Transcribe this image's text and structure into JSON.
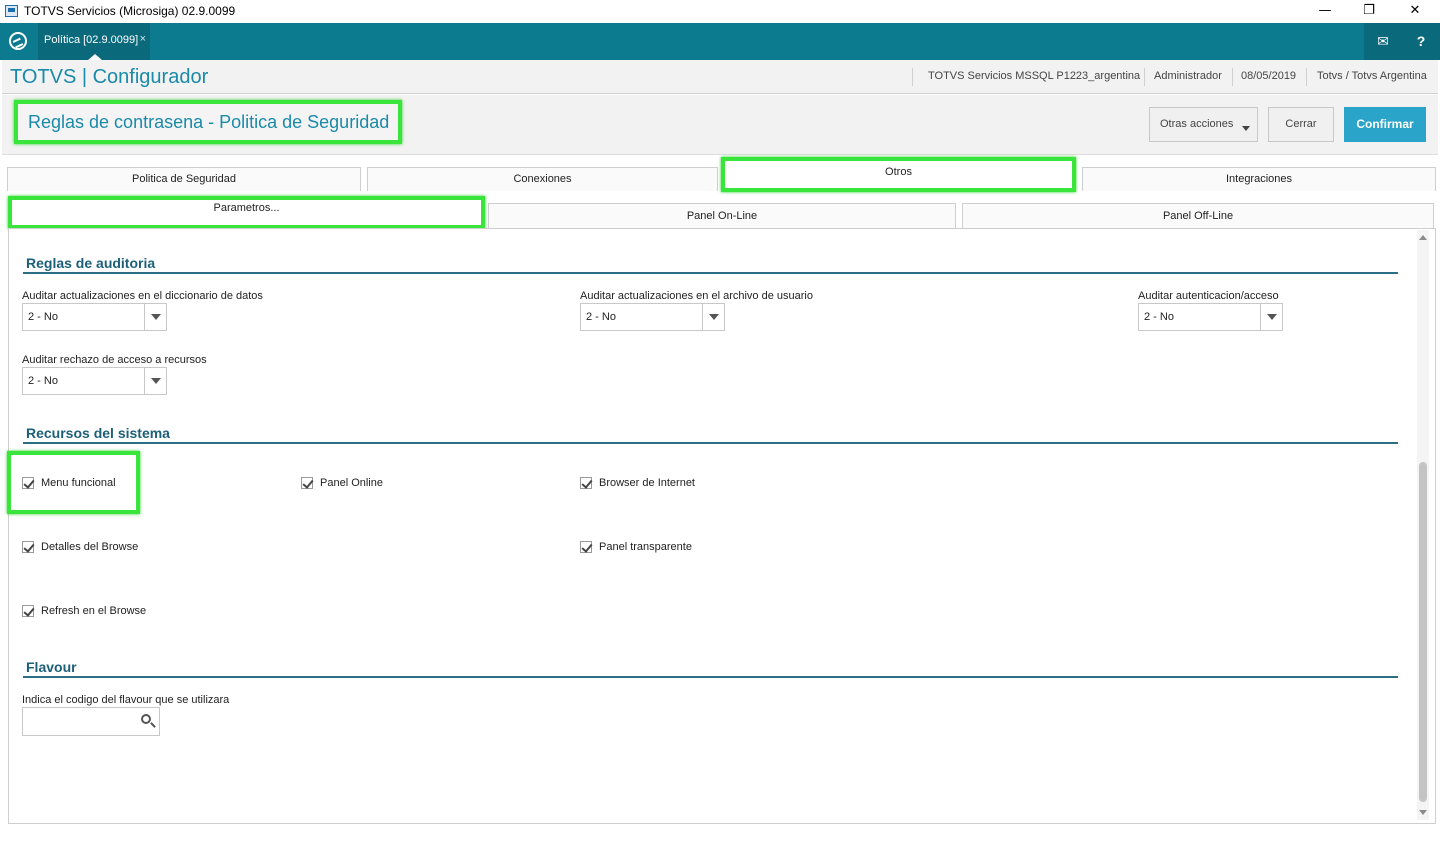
{
  "window": {
    "title": "TOTVS Servicios (Microsiga) 02.9.0099",
    "minimize": "—",
    "restore": "❐",
    "close": "✕"
  },
  "app_tab": {
    "label": "Política [02.9.0099]",
    "close": "×"
  },
  "header_icons": {
    "mail": "✉",
    "help": "?"
  },
  "header": {
    "brand": "TOTVS | Configurador",
    "server": "TOTVS Servicios MSSQL P1223_argentina",
    "user": "Administrador",
    "date": "08/05/2019",
    "company": "Totvs / Totvs Argentina"
  },
  "page": {
    "title": "Reglas de contrasena - Politica de Seguridad"
  },
  "actions": {
    "other": "Otras acciones",
    "close": "Cerrar",
    "confirm": "Confirmar"
  },
  "tabs": [
    {
      "label": "Politica de Seguridad"
    },
    {
      "label": "Conexiones"
    },
    {
      "label": "Otros"
    },
    {
      "label": "Integraciones"
    }
  ],
  "subtabs": [
    {
      "label": "Parametros..."
    },
    {
      "label": "Panel On-Line"
    },
    {
      "label": "Panel Off-Line"
    }
  ],
  "audit": {
    "title": "Reglas de auditoria",
    "fields": [
      {
        "label": "Auditar actualizaciones en el diccionario de datos",
        "value": "2 - No"
      },
      {
        "label": "Auditar actualizaciones en el archivo de usuario",
        "value": "2 - No"
      },
      {
        "label": "Auditar autenticacion/acceso",
        "value": "2 - No"
      },
      {
        "label": "Auditar rechazo de acceso a recursos",
        "value": "2 - No"
      }
    ]
  },
  "resources": {
    "title": "Recursos del sistema",
    "items": [
      {
        "label": "Menu funcional",
        "checked": true
      },
      {
        "label": "Panel Online",
        "checked": true
      },
      {
        "label": "Browser de Internet",
        "checked": true
      },
      {
        "label": "Detalles del Browse",
        "checked": true
      },
      {
        "label": "Panel transparente",
        "checked": true
      },
      {
        "label": "Refresh en el Browse",
        "checked": true
      }
    ]
  },
  "flavour": {
    "title": "Flavour",
    "label": "Indica el codigo del flavour que se utilizara",
    "value": ""
  },
  "colors": {
    "teal_bar": "#0d7b8f",
    "brand_text": "#1a8aa8",
    "confirm_button": "#2aa4c8",
    "highlight": "#39e53a",
    "section_title": "#1c5f7a"
  }
}
